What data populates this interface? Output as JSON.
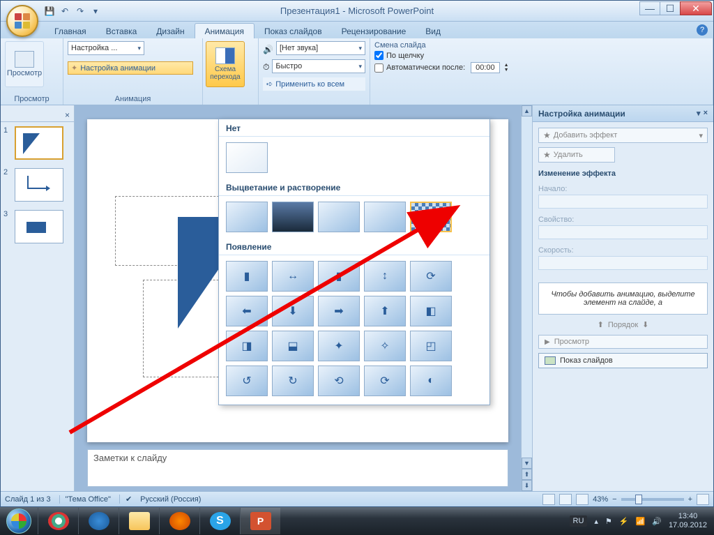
{
  "window": {
    "title": "Презентация1 - Microsoft PowerPoint"
  },
  "ribbon": {
    "tabs": [
      "Главная",
      "Вставка",
      "Дизайн",
      "Анимация",
      "Показ слайдов",
      "Рецензирование",
      "Вид"
    ],
    "active_tab": "Анимация",
    "groups": {
      "preview": {
        "label": "Просмотр",
        "button": "Просмотр"
      },
      "animation": {
        "label": "Анимация",
        "customize_combo": "Настройка ...",
        "customize_btn": "Настройка анимации"
      },
      "transition_scheme": {
        "label": "Схема перехода"
      },
      "sound_combo": "[Нет звука]",
      "speed_combo": "Быстро",
      "apply_all": "Применить ко всем",
      "advance": {
        "title": "Смена слайда",
        "on_click": "По щелчку",
        "auto_after": "Автоматически после:",
        "time": "00:00"
      }
    }
  },
  "gallery": {
    "none": "Нет",
    "fade": "Выцветание и растворение",
    "appear": "Появление"
  },
  "anim_pane": {
    "title": "Настройка анимации",
    "add_effect": "Добавить эффект",
    "remove": "Удалить",
    "change_effect": "Изменение эффекта",
    "start": "Начало:",
    "property": "Свойство:",
    "speed": "Скорость:",
    "hint": "Чтобы добавить анимацию, выделите элемент на слайде, а",
    "order": "Порядок",
    "preview": "Просмотр",
    "slideshow": "Показ слайдов"
  },
  "notes": "Заметки к слайду",
  "status": {
    "slide": "Слайд 1 из 3",
    "theme": "\"Тема Office\"",
    "lang": "Русский (Россия)",
    "zoom": "43%"
  },
  "tray": {
    "lang": "RU",
    "time": "13:40",
    "date": "17.09.2012"
  }
}
